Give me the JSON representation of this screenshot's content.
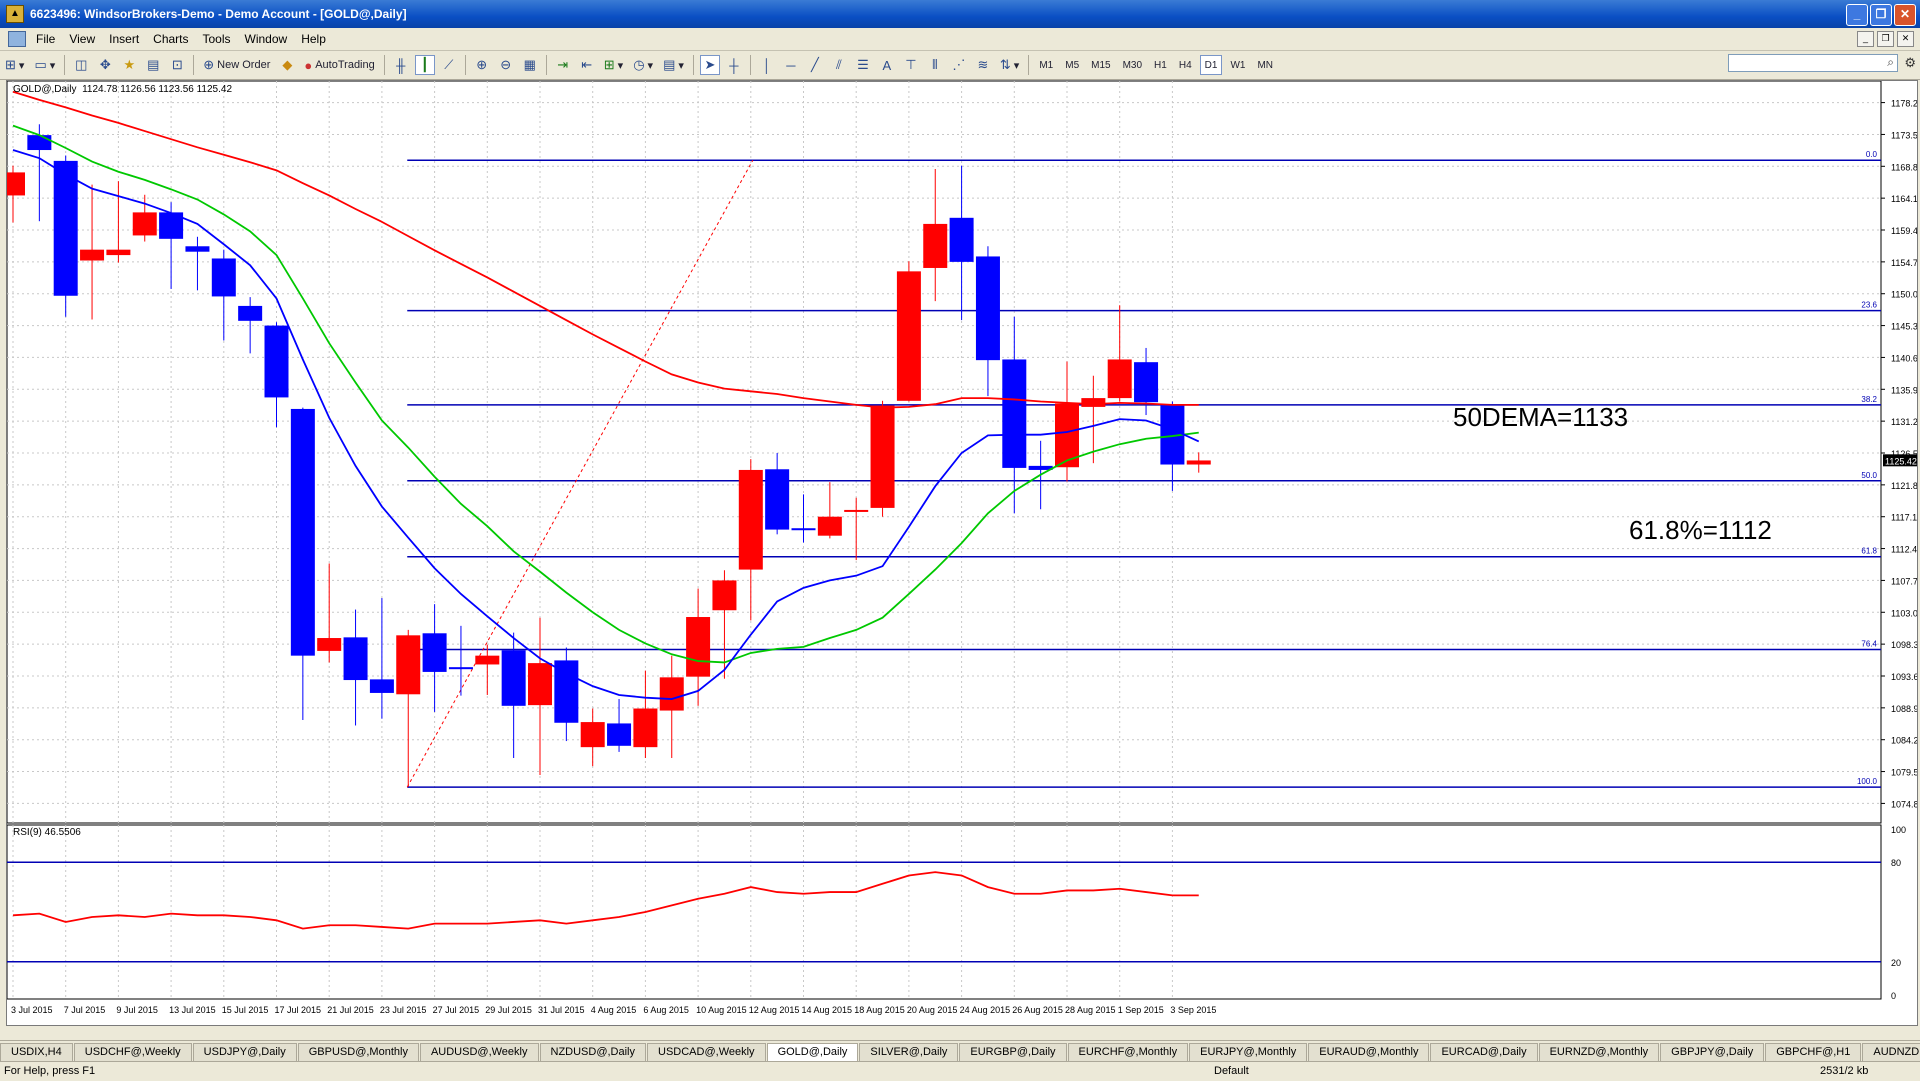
{
  "window": {
    "title": "6623496: WindsorBrokers-Demo - Demo Account - [GOLD@,Daily]",
    "app_icon": "metatrader-icon",
    "buttons": [
      "_",
      "❐",
      "✕"
    ]
  },
  "menu": {
    "items": [
      "File",
      "View",
      "Insert",
      "Charts",
      "Tools",
      "Window",
      "Help"
    ]
  },
  "toolbar": {
    "new_order": "New Order",
    "autotrading": "AutoTrading",
    "timeframes": [
      "M1",
      "M5",
      "M15",
      "M30",
      "H1",
      "H4",
      "D1",
      "W1",
      "MN"
    ],
    "active_timeframe": "D1",
    "search_placeholder": ""
  },
  "chart_header": {
    "symbol_label": "GOLD@,Daily",
    "ohlc": "1124.78 1126.56 1123.56 1125.42"
  },
  "annotations": {
    "dema": "50DEMA=1133",
    "fib618": "61.8%=1112"
  },
  "rsi_label": "RSI(9) 46.5506",
  "rsi_levels": [
    "100",
    "80",
    "20",
    "0"
  ],
  "current_price": "1125.42",
  "colors": {
    "bull": "#ff0000",
    "bear": "#0000ff",
    "grid": "#c8c8c8"
  },
  "chart_data": {
    "type": "candlestick",
    "price_axis_ticks": [
      "1178.20",
      "1173.50",
      "1168.80",
      "1164.10",
      "1159.40",
      "1154.70",
      "1150.00",
      "1145.30",
      "1140.60",
      "1135.90",
      "1131.20",
      "1126.50",
      "1121.80",
      "1117.10",
      "1112.40",
      "1107.70",
      "1103.00",
      "1098.30",
      "1093.60",
      "1088.90",
      "1084.20",
      "1079.50",
      "1074.80"
    ],
    "x_labels": [
      "3 Jul 2015",
      "7 Jul 2015",
      "9 Jul 2015",
      "13 Jul 2015",
      "15 Jul 2015",
      "17 Jul 2015",
      "21 Jul 2015",
      "23 Jul 2015",
      "27 Jul 2015",
      "29 Jul 2015",
      "31 Jul 2015",
      "4 Aug 2015",
      "6 Aug 2015",
      "10 Aug 2015",
      "12 Aug 2015",
      "14 Aug 2015",
      "18 Aug 2015",
      "20 Aug 2015",
      "24 Aug 2015",
      "26 Aug 2015",
      "28 Aug 2015",
      "1 Sep 2015",
      "3 Sep 2015"
    ],
    "candles": [
      {
        "o": 1164.5,
        "h": 1168.9,
        "l": 1160.5,
        "c": 1167.9
      },
      {
        "o": 1173.4,
        "h": 1175.0,
        "l": 1160.7,
        "c": 1171.2
      },
      {
        "o": 1169.6,
        "h": 1170.4,
        "l": 1146.6,
        "c": 1149.7
      },
      {
        "o": 1154.9,
        "h": 1166.1,
        "l": 1146.2,
        "c": 1156.5
      },
      {
        "o": 1155.7,
        "h": 1166.6,
        "l": 1154.6,
        "c": 1156.5
      },
      {
        "o": 1158.6,
        "h": 1164.6,
        "l": 1157.7,
        "c": 1162.0
      },
      {
        "o": 1162.0,
        "h": 1163.5,
        "l": 1150.7,
        "c": 1158.1
      },
      {
        "o": 1157.0,
        "h": 1158.4,
        "l": 1150.5,
        "c": 1156.2
      },
      {
        "o": 1155.2,
        "h": 1156.5,
        "l": 1143.1,
        "c": 1149.6
      },
      {
        "o": 1148.2,
        "h": 1149.5,
        "l": 1141.2,
        "c": 1146.0
      },
      {
        "o": 1145.3,
        "h": 1145.8,
        "l": 1130.3,
        "c": 1134.7
      },
      {
        "o": 1133.0,
        "h": 1133.2,
        "l": 1087.1,
        "c": 1096.6
      },
      {
        "o": 1097.3,
        "h": 1110.2,
        "l": 1095.6,
        "c": 1099.2
      },
      {
        "o": 1099.3,
        "h": 1103.4,
        "l": 1086.3,
        "c": 1093.0
      },
      {
        "o": 1093.1,
        "h": 1105.1,
        "l": 1087.3,
        "c": 1091.1
      },
      {
        "o": 1090.9,
        "h": 1100.4,
        "l": 1077.3,
        "c": 1099.6
      },
      {
        "o": 1099.9,
        "h": 1104.2,
        "l": 1088.3,
        "c": 1094.2
      },
      {
        "o": 1094.9,
        "h": 1101.0,
        "l": 1090.7,
        "c": 1094.7
      },
      {
        "o": 1095.3,
        "h": 1098.2,
        "l": 1090.8,
        "c": 1096.6
      },
      {
        "o": 1097.4,
        "h": 1100.0,
        "l": 1081.5,
        "c": 1089.2
      },
      {
        "o": 1089.3,
        "h": 1102.2,
        "l": 1079.0,
        "c": 1095.5
      },
      {
        "o": 1095.9,
        "h": 1097.8,
        "l": 1084.0,
        "c": 1086.7
      },
      {
        "o": 1083.1,
        "h": 1088.8,
        "l": 1080.3,
        "c": 1086.8
      },
      {
        "o": 1086.6,
        "h": 1090.2,
        "l": 1082.4,
        "c": 1083.3
      },
      {
        "o": 1083.1,
        "h": 1094.4,
        "l": 1081.5,
        "c": 1088.8
      },
      {
        "o": 1088.5,
        "h": 1096.6,
        "l": 1081.5,
        "c": 1093.4
      },
      {
        "o": 1093.5,
        "h": 1106.5,
        "l": 1089.2,
        "c": 1102.3
      },
      {
        "o": 1103.3,
        "h": 1109.2,
        "l": 1093.2,
        "c": 1107.7
      },
      {
        "o": 1109.3,
        "h": 1125.6,
        "l": 1101.8,
        "c": 1124.0
      },
      {
        "o": 1124.1,
        "h": 1126.5,
        "l": 1114.5,
        "c": 1115.2
      },
      {
        "o": 1115.4,
        "h": 1120.4,
        "l": 1113.3,
        "c": 1115.3
      },
      {
        "o": 1114.3,
        "h": 1122.2,
        "l": 1113.9,
        "c": 1117.1
      },
      {
        "o": 1117.9,
        "h": 1119.9,
        "l": 1110.7,
        "c": 1118.1
      },
      {
        "o": 1118.4,
        "h": 1134.2,
        "l": 1117.1,
        "c": 1133.5
      },
      {
        "o": 1134.2,
        "h": 1154.8,
        "l": 1134.1,
        "c": 1153.3
      },
      {
        "o": 1153.8,
        "h": 1168.4,
        "l": 1148.9,
        "c": 1160.3
      },
      {
        "o": 1161.2,
        "h": 1168.9,
        "l": 1146.1,
        "c": 1154.7
      },
      {
        "o": 1155.5,
        "h": 1157.0,
        "l": 1134.9,
        "c": 1140.2
      },
      {
        "o": 1140.3,
        "h": 1146.6,
        "l": 1117.6,
        "c": 1124.3
      },
      {
        "o": 1124.6,
        "h": 1128.3,
        "l": 1118.2,
        "c": 1124.0
      },
      {
        "o": 1124.4,
        "h": 1140.0,
        "l": 1122.3,
        "c": 1133.8
      },
      {
        "o": 1133.3,
        "h": 1137.9,
        "l": 1125.0,
        "c": 1134.6
      },
      {
        "o": 1134.6,
        "h": 1148.3,
        "l": 1134.1,
        "c": 1140.3
      },
      {
        "o": 1139.9,
        "h": 1142.0,
        "l": 1132.1,
        "c": 1134.0
      },
      {
        "o": 1133.6,
        "h": 1134.1,
        "l": 1120.9,
        "c": 1124.8
      },
      {
        "o": 1124.8,
        "h": 1126.6,
        "l": 1123.6,
        "c": 1125.4
      }
    ],
    "ema_red": [
      1179.8,
      1178.6,
      1177.5,
      1176.3,
      1175.2,
      1174.0,
      1172.8,
      1171.6,
      1170.5,
      1169.4,
      1168.2,
      1166.3,
      1164.5,
      1162.5,
      1160.6,
      1158.5,
      1156.4,
      1154.4,
      1152.4,
      1150.3,
      1148.2,
      1146.1,
      1144.0,
      1142.0,
      1140.0,
      1138.1,
      1136.9,
      1136.0,
      1135.6,
      1135.2,
      1134.6,
      1134.1,
      1133.6,
      1133.2,
      1133.3,
      1133.7,
      1134.6,
      1134.6,
      1134.4,
      1134.1,
      1133.9,
      1133.7,
      1133.9,
      1133.8,
      1133.6,
      1133.6
    ],
    "ema_green": [
      1174.8,
      1173.4,
      1171.5,
      1169.5,
      1168.0,
      1166.8,
      1165.4,
      1163.9,
      1161.7,
      1159.2,
      1155.7,
      1149.3,
      1142.7,
      1136.9,
      1131.3,
      1127.3,
      1123.0,
      1119.0,
      1115.7,
      1112.0,
      1109.0,
      1105.9,
      1103.0,
      1100.4,
      1098.4,
      1096.8,
      1095.8,
      1095.6,
      1097.0,
      1097.6,
      1097.9,
      1099.2,
      1100.4,
      1102.2,
      1105.7,
      1109.3,
      1113.2,
      1117.6,
      1120.9,
      1123.3,
      1125.4,
      1126.7,
      1127.8,
      1128.6,
      1129.0,
      1129.5
    ],
    "ema_blue": [
      1171.2,
      1170.0,
      1167.6,
      1165.5,
      1164.4,
      1163.3,
      1161.9,
      1160.3,
      1157.3,
      1154.2,
      1149.3,
      1140.3,
      1131.7,
      1124.6,
      1118.6,
      1114.0,
      1109.5,
      1105.7,
      1102.4,
      1099.2,
      1096.2,
      1094.0,
      1092.1,
      1090.8,
      1090.4,
      1090.2,
      1091.4,
      1094.5,
      1099.7,
      1104.6,
      1106.6,
      1107.7,
      1108.4,
      1109.8,
      1115.6,
      1121.6,
      1126.5,
      1129.1,
      1129.2,
      1129.2,
      1129.6,
      1130.5,
      1131.5,
      1131.3,
      1130.0,
      1128.2
    ],
    "fib_levels": [
      {
        "label": "0.0",
        "price": 1169.7
      },
      {
        "label": "23.6",
        "price": 1147.5
      },
      {
        "label": "38.2",
        "price": 1133.6
      },
      {
        "label": "50.0",
        "price": 1122.4
      },
      {
        "label": "61.8",
        "price": 1111.2
      },
      {
        "label": "76.4",
        "price": 1097.5
      },
      {
        "label": "100.0",
        "price": 1077.2
      }
    ],
    "rsi": [
      48,
      49,
      44,
      47,
      48,
      47,
      49,
      48,
      48,
      47,
      45,
      40,
      42,
      42,
      41,
      40,
      43,
      43,
      43,
      44,
      45,
      43,
      45,
      47,
      50,
      54,
      58,
      61,
      65,
      62,
      61,
      62,
      62,
      67,
      72,
      74,
      72,
      65,
      61,
      61,
      63,
      63,
      64,
      62,
      60,
      60
    ]
  }
}
